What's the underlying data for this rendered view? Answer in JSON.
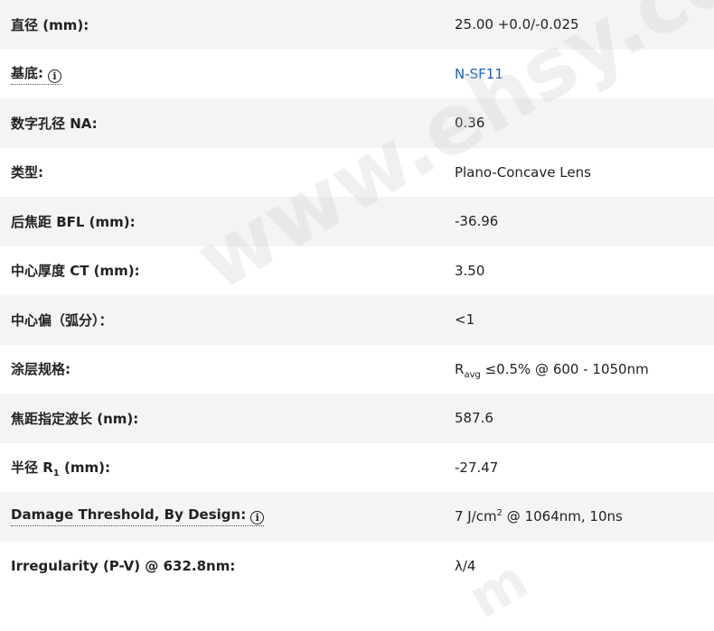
{
  "rows": [
    {
      "label": "直径 (mm):",
      "value": "25.00 +0.0/-0.025"
    },
    {
      "label": "基底:",
      "value": "N-SF11"
    },
    {
      "label": "数字孔径 NA:",
      "value": "0.36"
    },
    {
      "label": "类型:",
      "value": "Plano-Concave Lens"
    },
    {
      "label": "后焦距 BFL (mm):",
      "value": "-36.96"
    },
    {
      "label": "中心厚度 CT (mm):",
      "value": "3.50"
    },
    {
      "label": "中心偏（弧分）：",
      "value": "<1"
    },
    {
      "label": "涂层规格:",
      "value_prefix": "R",
      "value_sub": "avg",
      "value_suffix": " ≤0.5% @ 600 - 1050nm"
    },
    {
      "label": "焦距指定波长 (nm):",
      "value": "587.6"
    },
    {
      "label_prefix": "半径 R",
      "label_sub": "1",
      "label_suffix": " (mm):",
      "value": "-27.47"
    },
    {
      "label": "Damage Threshold, By Design:",
      "value_prefix": "7 J/cm",
      "value_sup": "2",
      "value_suffix": " @ 1064nm, 10ns"
    },
    {
      "label": "Irregularity (P-V) @ 632.8nm:",
      "value": "λ/4"
    }
  ],
  "info_icon_glyph": "i",
  "watermark": {
    "main": "www.ehsy.com",
    "partial": "m"
  },
  "colors": {
    "row_shaded": "#f4f4f4",
    "link": "#1a5fb4",
    "text": "#222222"
  }
}
